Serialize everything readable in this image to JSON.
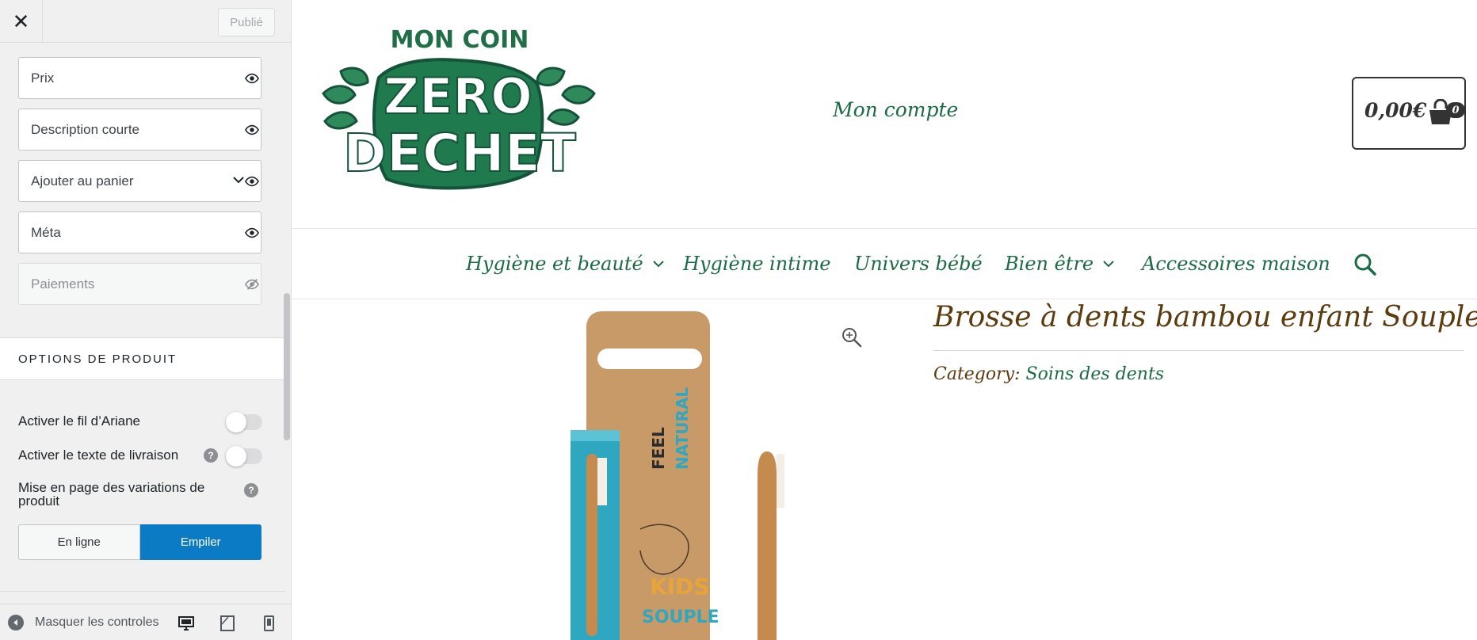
{
  "customizer": {
    "close_label": "✕",
    "publish_label": "Publié",
    "elements": [
      {
        "label": "Prix",
        "icon": "eye-icon",
        "enabled": true
      },
      {
        "label": "Description courte",
        "icon": "eye-icon",
        "enabled": true
      },
      {
        "label": "Ajouter au panier",
        "icon": "eye-icon",
        "expandable": true,
        "enabled": true
      },
      {
        "label": "Méta",
        "icon": "eye-icon",
        "enabled": true
      },
      {
        "label": "Paiements",
        "icon": "eye-slash-icon",
        "enabled": false
      }
    ],
    "section_title": "OPTIONS DE PRODUIT",
    "toggles": [
      {
        "label": "Activer le fil d’Ariane",
        "on": false
      },
      {
        "label": "Activer le texte de livraison",
        "on": false,
        "help": true
      }
    ],
    "variation_layout": {
      "label": "Mise en page des variations de produit",
      "options": [
        "En ligne",
        "Empiler"
      ],
      "selected": "Empiler"
    },
    "footer": {
      "collapse_label": "Masquer les controles",
      "devices": [
        "desktop-icon",
        "tablet-icon",
        "mobile-icon"
      ]
    },
    "accent_color": "#0a7bc4"
  },
  "site": {
    "logo_text": {
      "line1": "MON COIN",
      "line2": "ZERO",
      "line3": "DECHET"
    },
    "account_link": "Mon compte",
    "cart": {
      "total": "0,00€",
      "count": "0"
    },
    "nav": [
      {
        "label": "Hygiène et beauté",
        "dropdown": true
      },
      {
        "label": "Hygiène intime",
        "dropdown": false
      },
      {
        "label": "Univers bébé",
        "dropdown": false
      },
      {
        "label": "Bien être",
        "dropdown": true
      },
      {
        "label": "Accessoires maison",
        "dropdown": false
      }
    ],
    "brand_green": "#1d6b45",
    "product": {
      "title": "Brosse à dents bambou enfant Souple",
      "category_label": "Category:",
      "category_value": "Soins des dents",
      "packaging_text": {
        "feel": "FEEL",
        "natural": "NATURAL",
        "kids": "KIDS",
        "souple": "SOUPLE"
      }
    }
  }
}
